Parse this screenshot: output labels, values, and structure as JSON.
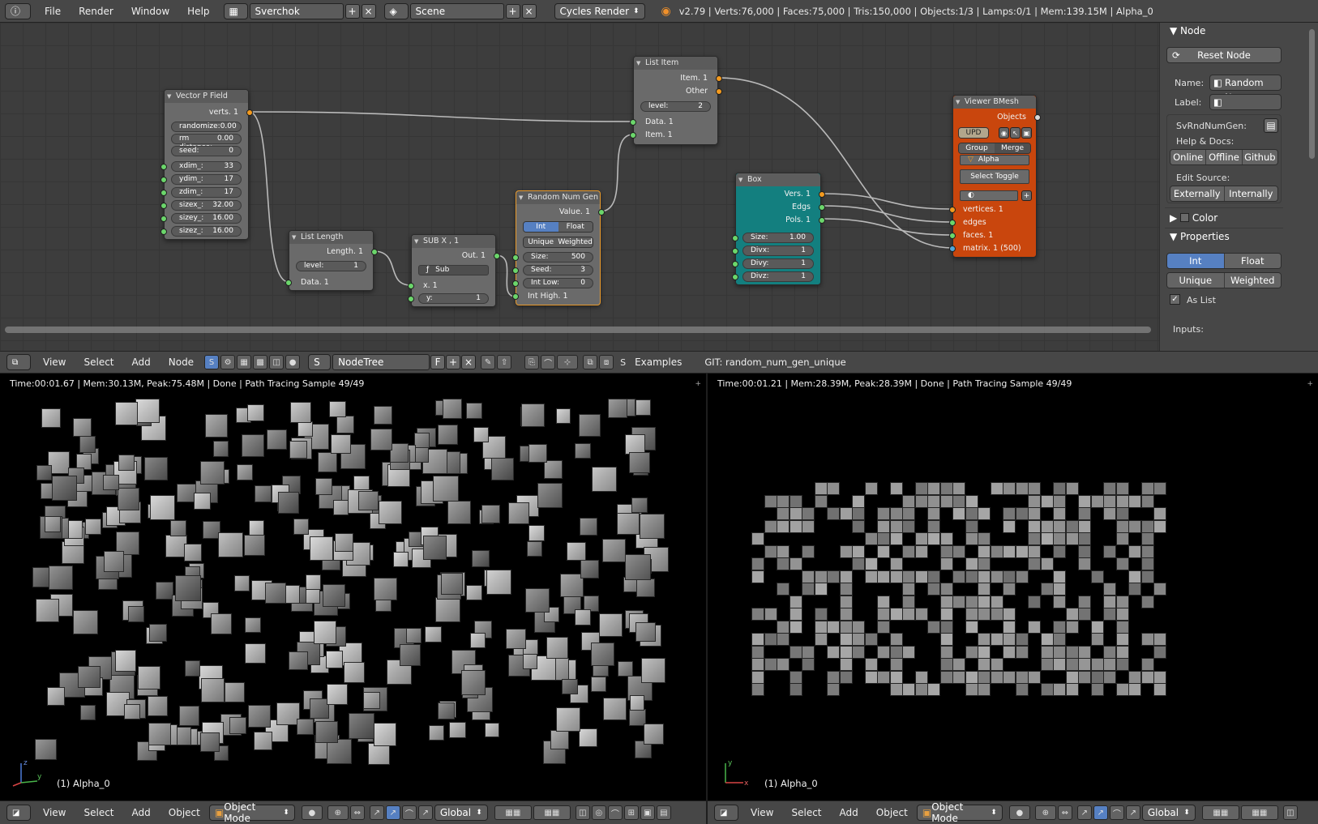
{
  "topbar": {
    "menus": [
      "File",
      "Render",
      "Window",
      "Help"
    ],
    "screen_layout": "Sverchok",
    "scene": "Scene",
    "render_engine": "Cycles Render",
    "stats": "v2.79 | Verts:76,000 | Faces:75,000 | Tris:150,000 | Objects:1/3 | Lamps:0/1 | Mem:139.15M | Alpha_0"
  },
  "nodes": {
    "vector_p_field": {
      "title": "Vector P Field",
      "output": "verts. 1",
      "params": [
        {
          "label": "randomize:",
          "value": "0.00"
        },
        {
          "label": "rm distance:",
          "value": "0.00"
        },
        {
          "label": "seed:",
          "value": "0"
        },
        {
          "label": "xdim_:",
          "value": "33"
        },
        {
          "label": "ydim_:",
          "value": "17"
        },
        {
          "label": "zdim_:",
          "value": "17"
        },
        {
          "label": "sizex_:",
          "value": "32.00"
        },
        {
          "label": "sizey_:",
          "value": "16.00"
        },
        {
          "label": "sizez_:",
          "value": "16.00"
        }
      ]
    },
    "list_length": {
      "title": "List Length",
      "output": "Length. 1",
      "level_label": "level:",
      "level_value": "1",
      "input": "Data. 1"
    },
    "sub": {
      "title": "SUB X , 1",
      "output": "Out. 1",
      "mode": "Sub",
      "input_x": "x. 1",
      "y_label": "y:",
      "y_value": "1"
    },
    "random_num_gen": {
      "title": "Random Num Gen",
      "output": "Value. 1",
      "type_options": [
        "Int",
        "Float"
      ],
      "mode_options": [
        "Unique",
        "Weighted"
      ],
      "params": [
        {
          "label": "Size:",
          "value": "500"
        },
        {
          "label": "Seed:",
          "value": "3"
        },
        {
          "label": "Int Low:",
          "value": "0"
        }
      ],
      "input": "Int High. 1"
    },
    "list_item": {
      "title": "List Item",
      "outputs": [
        "Item. 1",
        "Other"
      ],
      "level_label": "level:",
      "level_value": "2",
      "inputs": [
        "Data. 1",
        "Item. 1"
      ]
    },
    "box": {
      "title": "Box",
      "outputs": [
        "Vers. 1",
        "Edgs",
        "Pols. 1"
      ],
      "params": [
        {
          "label": "Size:",
          "value": "1.00"
        },
        {
          "label": "Divx:",
          "value": "1"
        },
        {
          "label": "Divy:",
          "value": "1"
        },
        {
          "label": "Divz:",
          "value": "1"
        }
      ]
    },
    "viewer_bmesh": {
      "title": "Viewer BMesh",
      "output": "Objects",
      "upd_label": "UPD",
      "group_options": [
        "Group",
        "Merge"
      ],
      "name_value": "Alpha",
      "select_toggle": "Select Toggle",
      "inputs": [
        "vertices. 1",
        "edges",
        "faces. 1",
        "matrix. 1 (500)"
      ]
    }
  },
  "npanel": {
    "section_node": "Node",
    "reset_button": "Reset Node",
    "name_label": "Name:",
    "name_value": "Random N...",
    "label_label": "Label:",
    "label_value": "",
    "class_name": "SvRndNumGen:",
    "help_docs": "Help & Docs:",
    "doc_buttons": [
      "Online",
      "Offline",
      "Github"
    ],
    "edit_source": "Edit Source:",
    "source_buttons": [
      "Externally",
      "Internally"
    ],
    "section_color": "Color",
    "section_properties": "Properties",
    "type_options": [
      "Int",
      "Float"
    ],
    "mode_options": [
      "Unique",
      "Weighted"
    ],
    "as_list": "As List",
    "inputs_label": "Inputs:"
  },
  "ne_header": {
    "menus": [
      "View",
      "Select",
      "Add",
      "Node"
    ],
    "tree_name": "NodeTree",
    "fake_user": "F",
    "examples": "Examples",
    "git": "GIT: random_num_gen_unique"
  },
  "view_left": {
    "info": "Time:00:01.67 | Mem:30.13M, Peak:75.48M | Done | Path Tracing Sample 49/49",
    "object": "(1) Alpha_0"
  },
  "view_right": {
    "info": "Time:00:01.21 | Mem:28.39M, Peak:28.39M | Done | Path Tracing Sample 49/49",
    "object": "(1) Alpha_0"
  },
  "bottom_bar": {
    "menus": [
      "View",
      "Select",
      "Add",
      "Object"
    ],
    "mode": "Object Mode",
    "orientation": "Global"
  }
}
